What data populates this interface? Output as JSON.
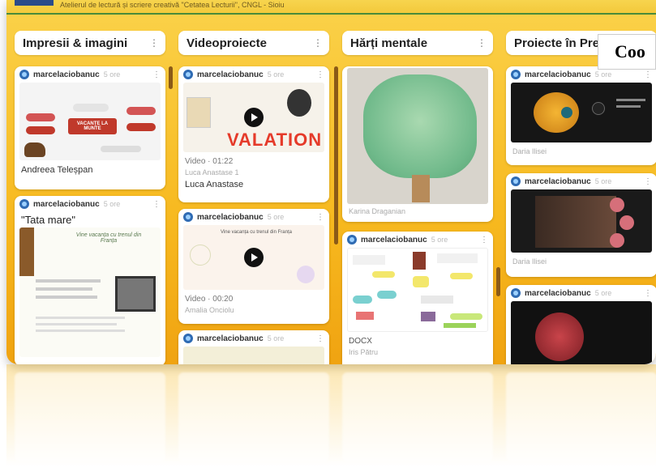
{
  "header": {
    "subtitle": "Atelierul de lectură și scriere creativă \"Cetatea Lecturii\", CNGL - Sioiu"
  },
  "overlay_label": "Coo",
  "columns": [
    {
      "title": "Impresii & imagini",
      "cards": [
        {
          "author": "marcelaciobanuc",
          "ago": "5 ore",
          "caption": "Andreea Teleșpan",
          "thumb_label": "VACANȚE LA MUNTE"
        },
        {
          "author": "marcelaciobanuc",
          "ago": "5 ore",
          "heading": "\"Tata mare\"",
          "thumb_label": "Vine vacanța cu trenul din Franța"
        }
      ]
    },
    {
      "title": "Videoproiecte",
      "cards": [
        {
          "author": "marcelaciobanuc",
          "ago": "5 ore",
          "video_meta": "Video · 01:22",
          "sub": "Luca Anastase 1",
          "caption": "Luca Anastase",
          "thumb_label": "VALATION"
        },
        {
          "author": "marcelaciobanuc",
          "ago": "5 ore",
          "video_meta": "Video · 00:20",
          "sub": "Amalia Onciolu",
          "thumb_label": "Vine vacanța cu trenul din Franța"
        },
        {
          "author": "marcelaciobanuc",
          "ago": "5 ore"
        }
      ]
    },
    {
      "title": "Hărți mentale",
      "cards": [
        {
          "sub": "Karina Draganian"
        },
        {
          "author": "marcelaciobanuc",
          "ago": "5 ore",
          "file_type": "DOCX",
          "sub": "Iris Pătru"
        }
      ]
    },
    {
      "title": "Proiecte în Prezi",
      "cards": [
        {
          "author": "marcelaciobanuc",
          "ago": "5 ore",
          "sub": "Daria Ilisei"
        },
        {
          "author": "marcelaciobanuc",
          "ago": "5 ore",
          "sub": "Daria Ilisei"
        },
        {
          "author": "marcelaciobanuc",
          "ago": "5 ore"
        }
      ]
    }
  ],
  "colors": {
    "board": "#f7b91f",
    "scrollbar": "#8b5a17",
    "avatar": "#2f6bb3"
  }
}
